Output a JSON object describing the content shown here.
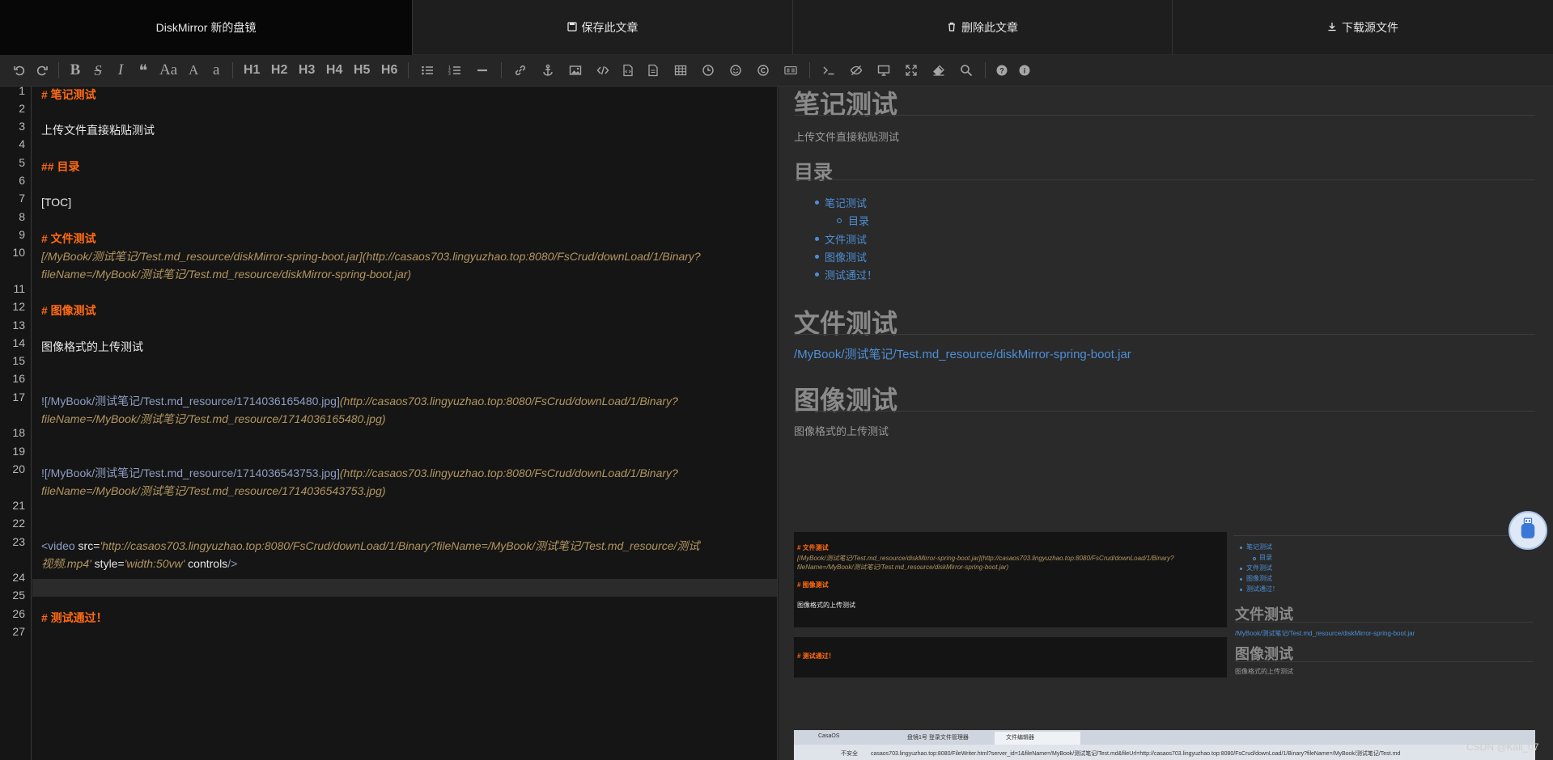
{
  "topbar": {
    "brand": "DiskMirror  新的盘镜",
    "save": "保存此文章",
    "delete": "删除此文章",
    "download": "下载源文件"
  },
  "toolbar": {
    "h1": "H1",
    "h2": "H2",
    "h3": "H3",
    "h4": "H4",
    "h5": "H5",
    "h6": "H6",
    "bold": "B",
    "strike": "S",
    "italic": "I",
    "quote": "❝",
    "ucase": "Aa",
    "upper": "A",
    "lower": "a"
  },
  "editor": {
    "line_numbers": [
      "1",
      "2",
      "3",
      "4",
      "5",
      "6",
      "7",
      "8",
      "9",
      "10",
      "11",
      "12",
      "13",
      "14",
      "15",
      "16",
      "17",
      "18",
      "19",
      "20",
      "21",
      "22",
      "23",
      "24",
      "25",
      "26",
      "27"
    ],
    "l1": "# 笔记测试",
    "l3": "上传文件直接粘贴测试",
    "l5": "## 目录",
    "l7": "[TOC]",
    "l9": "# 文件测试",
    "l10a": "[/MyBook/测试笔记/Test.md_resource/diskMirror-spring-boot.jar](http://casaos703.lingyuzhao.top:8080/FsCrud/downLoad/1/Binary?",
    "l10b": "fileName=/MyBook/测试笔记/Test.md_resource/diskMirror-spring-boot.jar)",
    "l12": "# 图像测试",
    "l14": "图像格式的上传测试",
    "l17a_link": "![/MyBook/测试笔记/Test.md_resource/1714036165480.jpg]",
    "l17a_url": "(http://casaos703.lingyuzhao.top:8080/FsCrud/downLoad/1/Binary?",
    "l17b": "fileName=/MyBook/测试笔记/Test.md_resource/1714036165480.jpg)",
    "l20a_link": "![/MyBook/测试笔记/Test.md_resource/1714036543753.jpg]",
    "l20a_url": "(http://casaos703.lingyuzhao.top:8080/FsCrud/downLoad/1/Binary?",
    "l20b": "fileName=/MyBook/测试笔记/Test.md_resource/1714036543753.jpg)",
    "l23a_tag": "<video",
    "l23a_attr": " src=",
    "l23a_val": "'http://casaos703.lingyuzhao.top:8080/FsCrud/downLoad/1/Binary?fileName=/MyBook/测试笔记/Test.md_resource/测试",
    "l23b_val": "视频.mp4'",
    "l23b_style": " style=",
    "l23b_styleval": "'width:50vw'",
    "l23b_controls": " controls",
    "l23b_close": "/>",
    "l25": "# 测试通过！"
  },
  "preview": {
    "h_note": "笔记测试",
    "p_upload": "上传文件直接粘贴测试",
    "h_toc": "目录",
    "toc": [
      "笔记测试",
      "目录",
      "文件测试",
      "图像测试",
      "测试通过！"
    ],
    "h_file": "文件测试",
    "file_link": "/MyBook/测试笔记/Test.md_resource/diskMirror-spring-boot.jar",
    "h_image": "图像测试",
    "p_image": "图像格式的上传测试",
    "shot1": {
      "h_file": "# 文件测试",
      "l1": "[/MyBook/测试笔记/Test.md_resource/diskMirror-spring-boot.jar](http://casaos703.lingyuzhao.top:8080/FsCrud/downLoad/1/Binary?",
      "l2": "fileName=/MyBook/测试笔记/Test.md_resource/diskMirror-spring-boot.jar)",
      "h_image": "# 图像测试",
      "p_image": "图像格式的上传测试",
      "h_pass": "# 测试通过！"
    },
    "shot2": {
      "toc": [
        "笔记测试",
        "目录",
        "文件测试",
        "图像测试",
        "测试通过！"
      ],
      "h_file": "文件测试",
      "file_link": "/MyBook/测试笔记/Test.md_resource/diskMirror-spring-boot.jar",
      "h_image": "图像测试",
      "p_image": "图像格式的上传测试"
    },
    "shot3": {
      "tab1": "CasaOS",
      "tab2": "盘镜1号 登录文件管理器",
      "tab3": "文件编辑器",
      "address": "casaos703.lingyuzhao.top:8080/FileWriter.html?server_id=1&fileName=/MyBook/测试笔记/Test.md&fileUrl=http://casaos703.lingyuzhao.top:8080/FsCrud/downLoad/1/Binary?fileName=/MyBook/测试笔记/Test.md",
      "insecure": "不安全"
    }
  },
  "watermark": "CSDN @Kali_07"
}
